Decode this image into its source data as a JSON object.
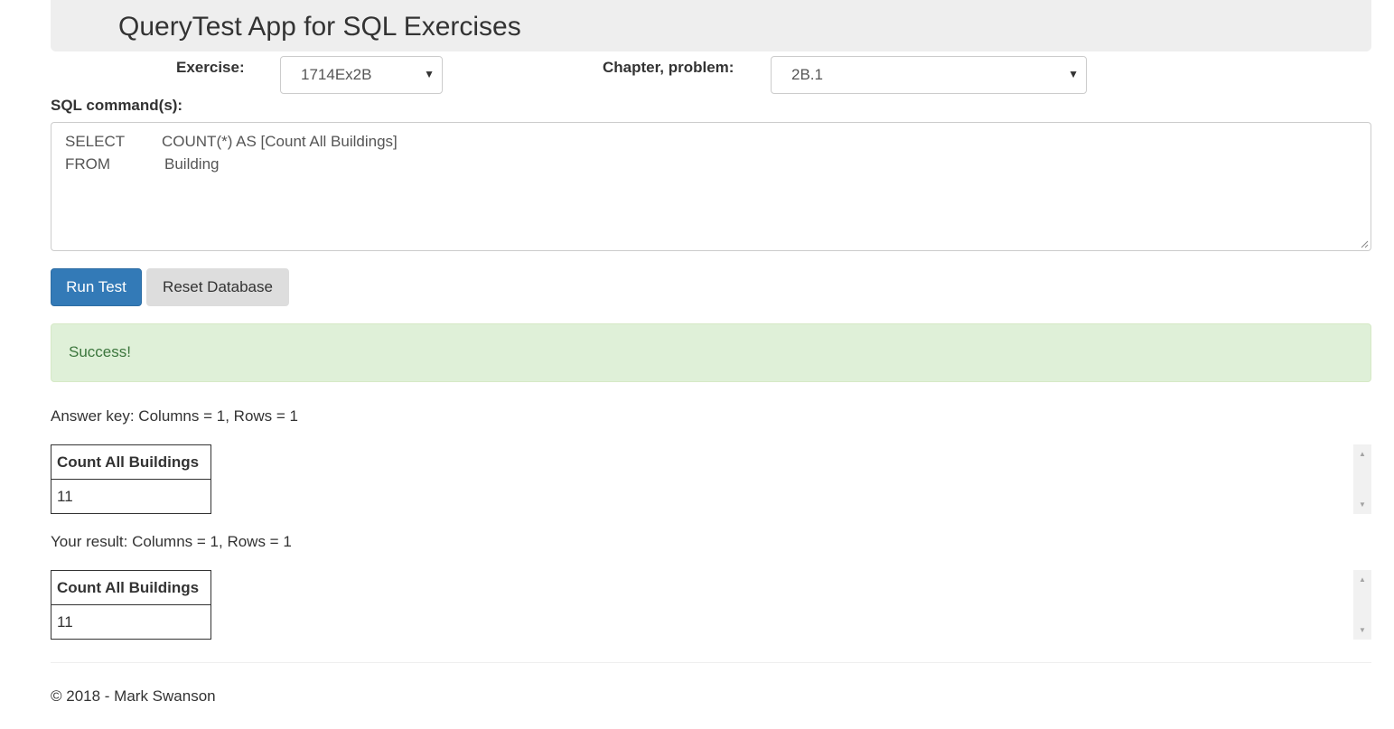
{
  "header": {
    "title": "QueryTest App for SQL Exercises"
  },
  "form": {
    "exercise_label": "Exercise:",
    "exercise_value": "1714Ex2B",
    "chapter_label": "Chapter, problem:",
    "chapter_value": "2B.1",
    "sql_label": "SQL command(s):",
    "sql_lines": [
      {
        "keyword": "SELECT",
        "expr": "COUNT(*) AS [Count All Buildings]"
      },
      {
        "keyword": "FROM",
        "expr": "Building"
      }
    ]
  },
  "buttons": {
    "run_label": "Run Test",
    "reset_label": "Reset Database"
  },
  "alert": {
    "message": "Success!"
  },
  "answer_key": {
    "summary": "Answer key: Columns = 1, Rows = 1",
    "columns": [
      "Count All Buildings"
    ],
    "rows": [
      [
        "11"
      ]
    ]
  },
  "your_result": {
    "summary": "Your result: Columns = 1, Rows = 1",
    "columns": [
      "Count All Buildings"
    ],
    "rows": [
      [
        "11"
      ]
    ]
  },
  "footer": {
    "text": "© 2018 - Mark Swanson"
  },
  "colors": {
    "primary": "#337ab7",
    "success_bg": "#dff0d8",
    "success_text": "#3c763d",
    "header_bg": "#eeeeee"
  },
  "icons": {
    "select_arrow": "caret-down-icon",
    "scroll_up": "scroll-up-icon",
    "scroll_down": "scroll-down-icon",
    "resize": "resize-handle-icon"
  }
}
